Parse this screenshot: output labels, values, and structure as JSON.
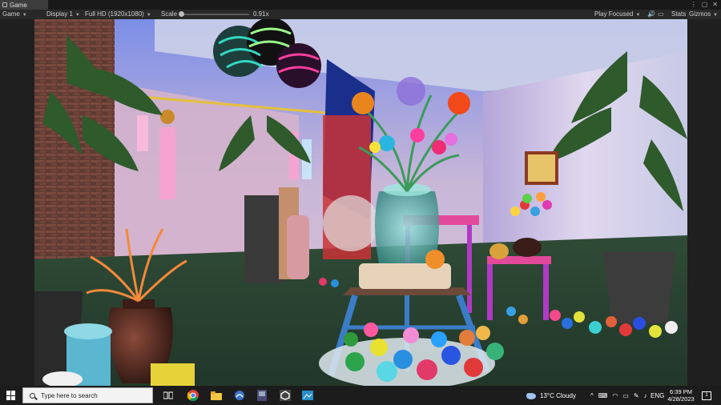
{
  "editor": {
    "tab_title": "Game",
    "mode_dropdown": "Game",
    "display_dropdown": "Display 1",
    "resolution_dropdown": "Full HD (1920x1080)",
    "scale_label": "Scale",
    "scale_value": "0.91x",
    "play_mode_dropdown": "Play Focused",
    "stats_label": "Stats",
    "gizmos_label": "Gizmos"
  },
  "taskbar": {
    "search_placeholder": "Type here to search",
    "weather": "13°C  Cloudy",
    "language": "ENG",
    "time": "6:39 PM",
    "date": "4/28/2023",
    "notification_count": "1"
  },
  "colors": {
    "accent": "#3c8ce6",
    "taskbar_bg": "#1c1c1c",
    "editor_bg": "#282828"
  }
}
